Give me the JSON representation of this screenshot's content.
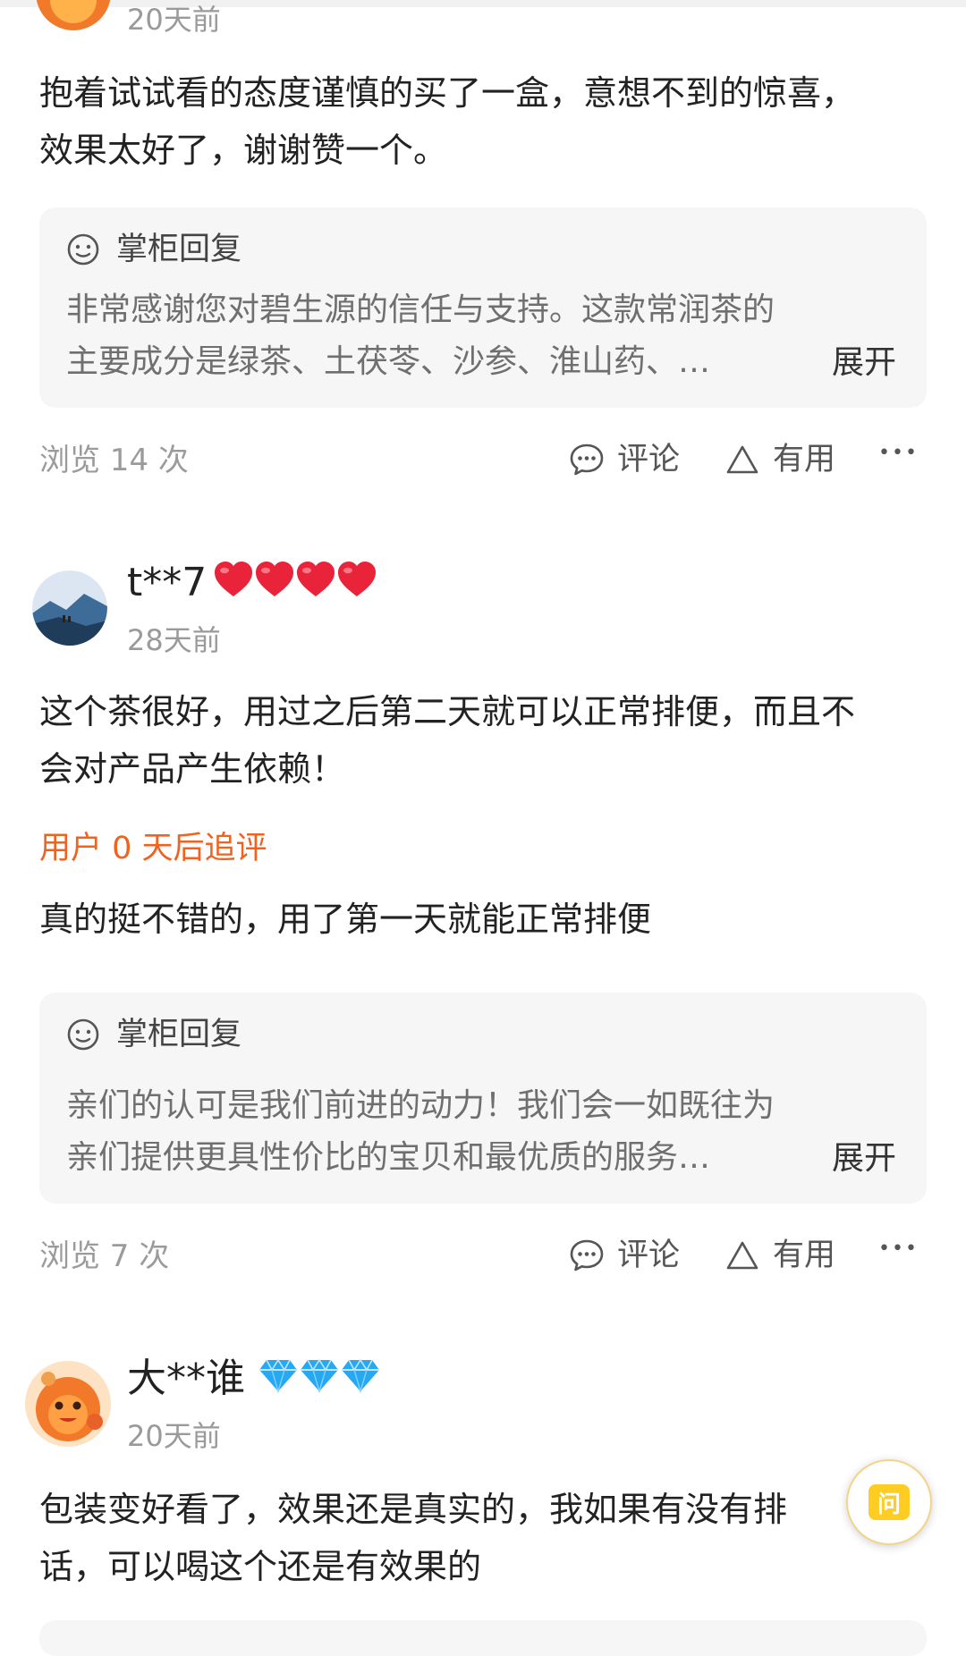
{
  "review1": {
    "date": "20天前",
    "text_line1": "抱着试试看的态度谨慎的买了一盒，意想不到的惊喜，",
    "text_line2": "效果太好了，谢谢赞一个。",
    "reply": {
      "label": "掌柜回复",
      "line1": "非常感谢您对碧生源的信任与支持。这款常润茶的",
      "line2": "主要成分是绿茶、土茯苓、沙参、淮山药、…",
      "expand": "展开"
    },
    "views": "浏览 14 次",
    "comment": "评论",
    "useful": "有用",
    "more": "•••"
  },
  "review2": {
    "nickname": "t**7",
    "level_badge": "hearts-4",
    "date": "28天前",
    "text_line1": "这个茶很好，用过之后第二天就可以正常排便，而且不",
    "text_line2": "会对产品产生依赖！",
    "followup_title": "用户 0 天后追评",
    "followup_text": "真的挺不错的，用了第一天就能正常排便",
    "reply": {
      "label": "掌柜回复",
      "line1": "亲们的认可是我们前进的动力！我们会一如既往为",
      "line2": "亲们提供更具性价比的宝贝和最优质的服务…",
      "expand": "展开"
    },
    "views": "浏览 7 次",
    "comment": "评论",
    "useful": "有用",
    "more": "•••"
  },
  "review3": {
    "nickname": "大**谁",
    "level_badge": "diamonds-3",
    "date": "20天前",
    "text_line1": "包装变好看了，效果还是真实的，我如果有没有排",
    "text_line2": "话，可以喝这个还是有效果的"
  },
  "ask_button": {
    "label": "问",
    "accent": "#ffcc22"
  },
  "colors": {
    "followup": "#f0621e",
    "meta": "#9a9a9a",
    "reply_bg": "#f6f6f6"
  }
}
